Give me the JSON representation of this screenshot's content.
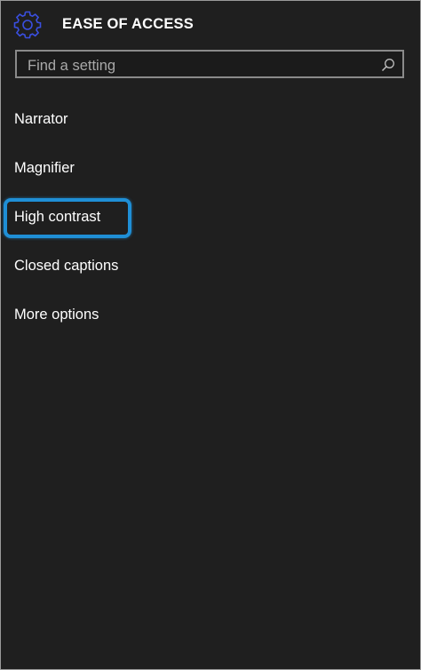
{
  "header": {
    "title": "EASE OF ACCESS",
    "icon": "gear-icon"
  },
  "search": {
    "placeholder": "Find a setting",
    "icon": "search-icon"
  },
  "menu": {
    "items": [
      {
        "label": "Narrator"
      },
      {
        "label": "Magnifier"
      },
      {
        "label": "High contrast"
      },
      {
        "label": "Closed captions"
      },
      {
        "label": "More options"
      }
    ]
  },
  "highlighted_item": "High contrast",
  "colors": {
    "background": "#1f1f1f",
    "accent_gear": "#3a4fe0",
    "highlight_border": "#1f8fd6",
    "search_border": "#8a8a8a"
  }
}
